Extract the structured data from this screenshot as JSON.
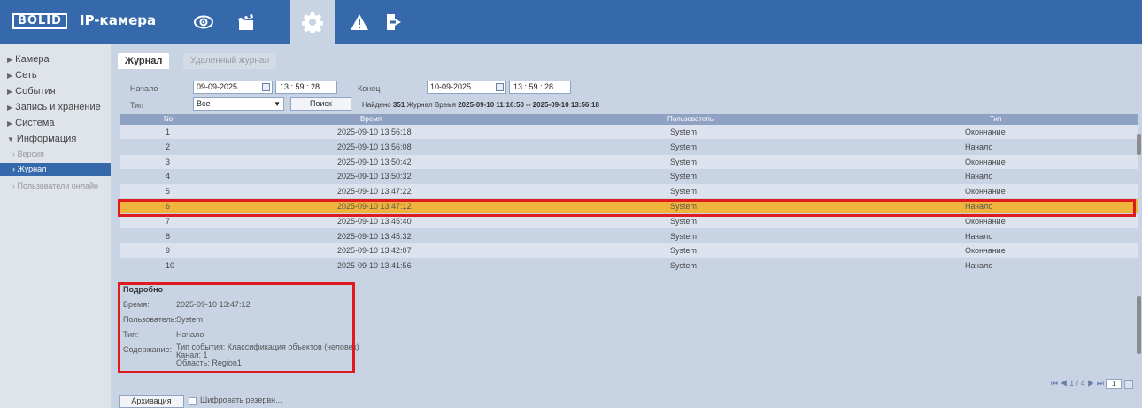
{
  "header": {
    "logo": "BOLID",
    "product": "IP-камера",
    "nav": [
      {
        "name": "live-view-icon"
      },
      {
        "name": "playback-icon"
      },
      {
        "name": "settings-icon"
      },
      {
        "name": "alarm-icon"
      },
      {
        "name": "logout-icon"
      }
    ],
    "active_nav": "settings-icon"
  },
  "sidebar": {
    "items": [
      {
        "label": "Камера"
      },
      {
        "label": "Сеть"
      },
      {
        "label": "События"
      },
      {
        "label": "Запись и хранение"
      },
      {
        "label": "Система"
      },
      {
        "label": "Информация"
      }
    ],
    "sub_items": [
      {
        "label": "Версия"
      },
      {
        "label": "Журнал"
      },
      {
        "label": "Пользователи онлайн"
      }
    ]
  },
  "tabs": {
    "active": "Журнал",
    "remote": "Удаленный журнал"
  },
  "filter": {
    "start_label": "Начало",
    "start_date": "09-09-2025",
    "start_time": "13 : 59 : 28",
    "end_label": "Конец",
    "end_date": "10-09-2025",
    "end_time": "13 : 59 : 28",
    "type_label": "Тип",
    "type_value": "Все",
    "search_button": "Поиск",
    "found_prefix": "Найдено",
    "found_count": "351",
    "found_suffix": "Журнал Время",
    "found_range": "2025-09-10 11:16:50 -- 2025-09-10 13:56:18"
  },
  "table": {
    "columns": [
      "No.",
      "Время",
      "Пользователь",
      "Тип"
    ],
    "rows": [
      {
        "no": "1",
        "time": "2025-09-10 13:56:18",
        "user": "System",
        "type": "Окончание"
      },
      {
        "no": "2",
        "time": "2025-09-10 13:56:08",
        "user": "System",
        "type": "Начало"
      },
      {
        "no": "3",
        "time": "2025-09-10 13:50:42",
        "user": "System",
        "type": "Окончание"
      },
      {
        "no": "4",
        "time": "2025-09-10 13:50:32",
        "user": "System",
        "type": "Начало"
      },
      {
        "no": "5",
        "time": "2025-09-10 13:47:22",
        "user": "System",
        "type": "Окончание"
      },
      {
        "no": "6",
        "time": "2025-09-10 13:47:12",
        "user": "System",
        "type": "Начало"
      },
      {
        "no": "7",
        "time": "2025-09-10 13:45:40",
        "user": "System",
        "type": "Окончание"
      },
      {
        "no": "8",
        "time": "2025-09-10 13:45:32",
        "user": "System",
        "type": "Начало"
      },
      {
        "no": "9",
        "time": "2025-09-10 13:42:07",
        "user": "System",
        "type": "Окончание"
      },
      {
        "no": "10",
        "time": "2025-09-10 13:41:56",
        "user": "System",
        "type": "Начало"
      }
    ],
    "selected_row": 6
  },
  "detail": {
    "title": "Подробно",
    "time_label": "Время:",
    "time_value": "2025-09-10 13:47:12",
    "user_label": "Пользователь:",
    "user_value": "System",
    "type_label": "Тип:",
    "type_value": "Начало",
    "content_label": "Содержание:",
    "content_lines": [
      "Тип события: Классификация объектов (человек)",
      "Канал: 1",
      "Область: Region1"
    ]
  },
  "pager": {
    "text": "1 / 4",
    "page_input": "1"
  },
  "footer": {
    "archive_button": "Архивация",
    "encrypt_label": "Шифровать резервн..."
  },
  "colors": {
    "header_bg": "#3569ab",
    "panel_bg": "#c8d3e4",
    "selected_row": "#f0b43c",
    "highlight_border": "#e01b1b"
  }
}
